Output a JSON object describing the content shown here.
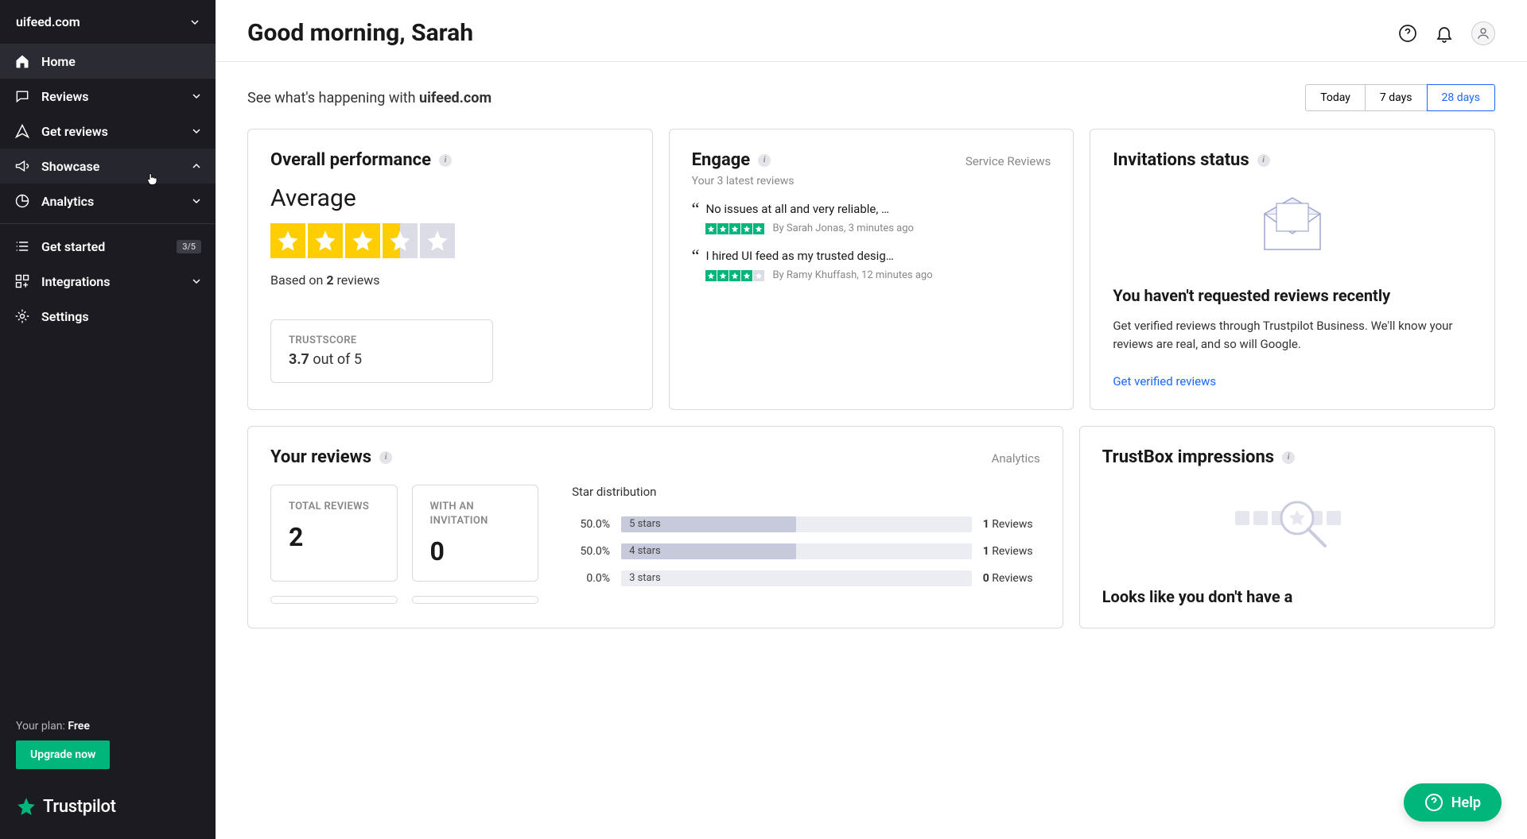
{
  "sidebar": {
    "site": "uifeed.com",
    "items": [
      {
        "icon": "home",
        "label": "Home",
        "expandable": false,
        "active": true
      },
      {
        "icon": "reviews",
        "label": "Reviews",
        "expandable": true
      },
      {
        "icon": "getreviews",
        "label": "Get reviews",
        "expandable": true
      },
      {
        "icon": "showcase",
        "label": "Showcase",
        "expandable": true,
        "expanded": true,
        "hover": true
      },
      {
        "icon": "analytics",
        "label": "Analytics",
        "expandable": true
      }
    ],
    "lower": [
      {
        "icon": "list",
        "label": "Get started",
        "badge": "3/5"
      },
      {
        "icon": "integrations",
        "label": "Integrations",
        "expandable": true
      },
      {
        "icon": "settings",
        "label": "Settings"
      }
    ],
    "plan_prefix": "Your plan: ",
    "plan_name": "Free",
    "upgrade_label": "Upgrade now",
    "logo_text": "Trustpilot"
  },
  "header": {
    "greeting": "Good morning, Sarah"
  },
  "content": {
    "happening_prefix": "See what's happening with ",
    "happening_site": "uifeed.com",
    "range": [
      "Today",
      "7 days",
      "28 days"
    ],
    "range_active": 2
  },
  "overall": {
    "title": "Overall performance",
    "rating_label": "Average",
    "stars": 3.5,
    "based_prefix": "Based on ",
    "based_count": "2",
    "based_suffix": " reviews",
    "ts_label": "TRUSTSCORE",
    "ts_value": "3.7",
    "ts_suffix": " out of 5"
  },
  "engage": {
    "title": "Engage",
    "link": "Service Reviews",
    "subtitle": "Your 3 latest reviews",
    "reviews": [
      {
        "text": "No issues at all and very reliable, …",
        "stars": 5,
        "by": "By Sarah Jonas, 3 minutes ago"
      },
      {
        "text": "I hired UI feed as my trusted desig…",
        "stars": 4,
        "by": "By Ramy Khuffash, 12 minutes ago"
      }
    ]
  },
  "invitations": {
    "title": "Invitations status",
    "heading": "You haven't requested reviews recently",
    "text": "Get verified reviews through Trustpilot Business. We'll know your reviews are real, and so will Google.",
    "link": "Get verified reviews"
  },
  "yourreviews": {
    "title": "Your reviews",
    "link": "Analytics",
    "total_label": "TOTAL REVIEWS",
    "total_value": "2",
    "inv_label": "WITH AN INVITATION",
    "inv_value": "0",
    "dist_title": "Star distribution",
    "dist": [
      {
        "pct": "50.0%",
        "label": "5 stars",
        "fill": 50,
        "count": "1",
        "count_suffix": " Reviews"
      },
      {
        "pct": "50.0%",
        "label": "4 stars",
        "fill": 50,
        "count": "1",
        "count_suffix": " Reviews"
      },
      {
        "pct": "0.0%",
        "label": "3 stars",
        "fill": 0,
        "count": "0",
        "count_suffix": " Reviews"
      }
    ]
  },
  "trustbox": {
    "title": "TrustBox impressions",
    "text": "Looks like you don't have a"
  },
  "help": {
    "label": "Help"
  }
}
